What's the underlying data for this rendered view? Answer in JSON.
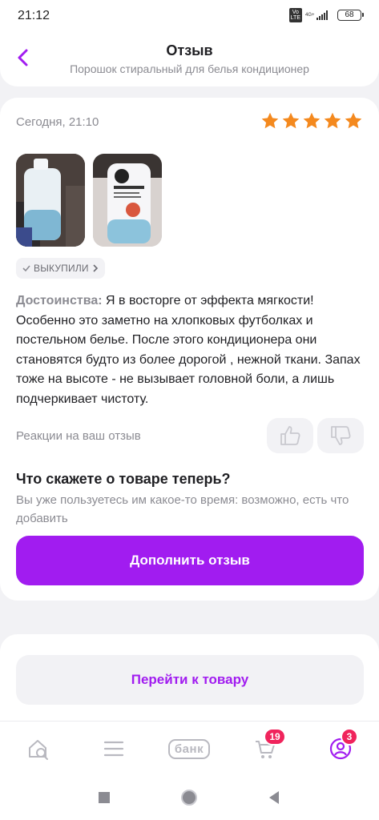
{
  "status_bar": {
    "time": "21:12",
    "volte": "Vo\nLTE",
    "network": "4G+",
    "battery": "68"
  },
  "header": {
    "title": "Отзыв",
    "subtitle": "Порошок стиральный для белья кондиционер"
  },
  "review": {
    "date": "Сегодня, 21:10",
    "rating": 5,
    "rating_max": 5,
    "star_color": "#f4891e",
    "badge": "ВЫКУПИЛИ",
    "pros_label": "Достоинства:",
    "pros_text": "Я в восторге от эффекта мягкости! Особенно это заметно на хлопковых футболках и постельном белье. После этого кондиционера они становятся будто из более дорогой , нежной ткани. Запах тоже на высоте - не вызывает головной боли, а лишь подчеркивает чистоту.",
    "photo_count": 2
  },
  "reactions": {
    "label": "Реакции на ваш отзыв"
  },
  "followup": {
    "title": "Что скажете о товаре теперь?",
    "text": "Вы уже пользуетесь им какое-то время: возможно, есть что добавить",
    "button": "Дополнить отзыв"
  },
  "go_to_product": {
    "button": "Перейти к товару"
  },
  "tab_bar": {
    "bank_label": "банк",
    "cart_count": "19",
    "profile_count": "3"
  },
  "colors": {
    "accent": "#a11cf0",
    "badge": "#f0245c",
    "star": "#f4891e"
  }
}
